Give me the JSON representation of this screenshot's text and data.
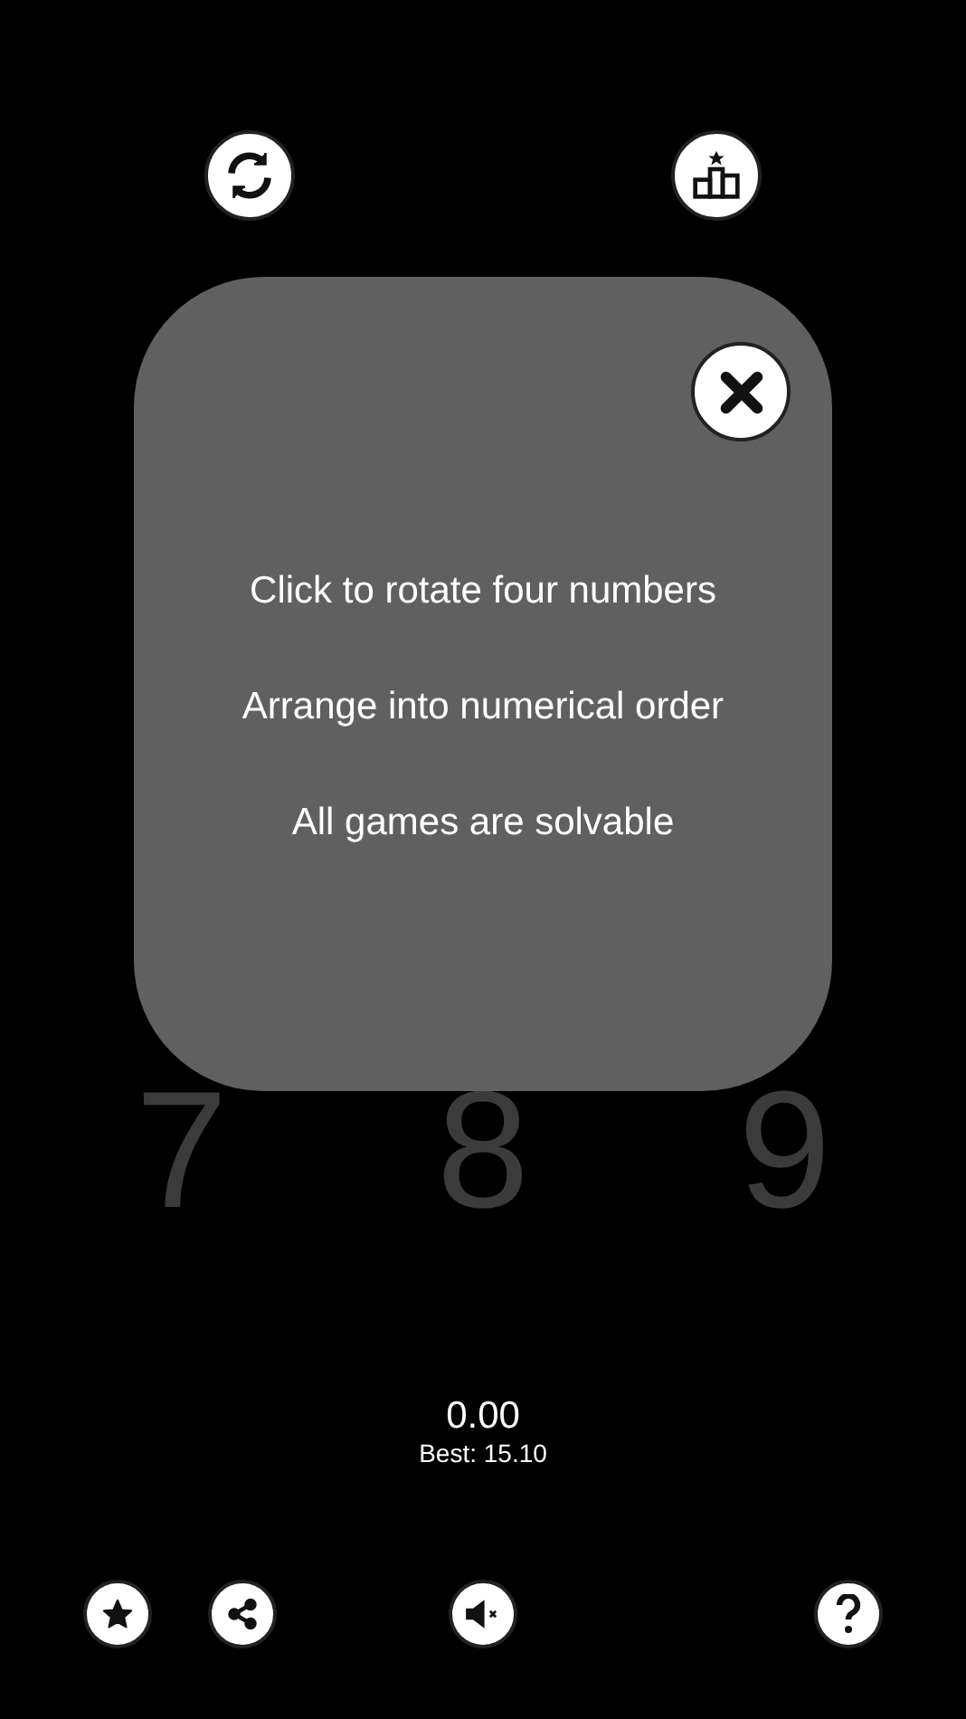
{
  "top_buttons": [
    {
      "kind": "refresh"
    },
    {
      "kind": "leaderboard"
    }
  ],
  "grid": [
    "7",
    "8",
    "9"
  ],
  "help_dialog": {
    "lines": [
      "Click to rotate four numbers",
      "Arrange into numerical order",
      "All games are solvable"
    ]
  },
  "timer": {
    "time": "0.00",
    "best": "Best: 15.10"
  },
  "bottom_buttons": [
    {
      "kind": "star"
    },
    {
      "kind": "share"
    },
    {
      "kind": "mute"
    },
    {
      "kind": "help"
    }
  ]
}
